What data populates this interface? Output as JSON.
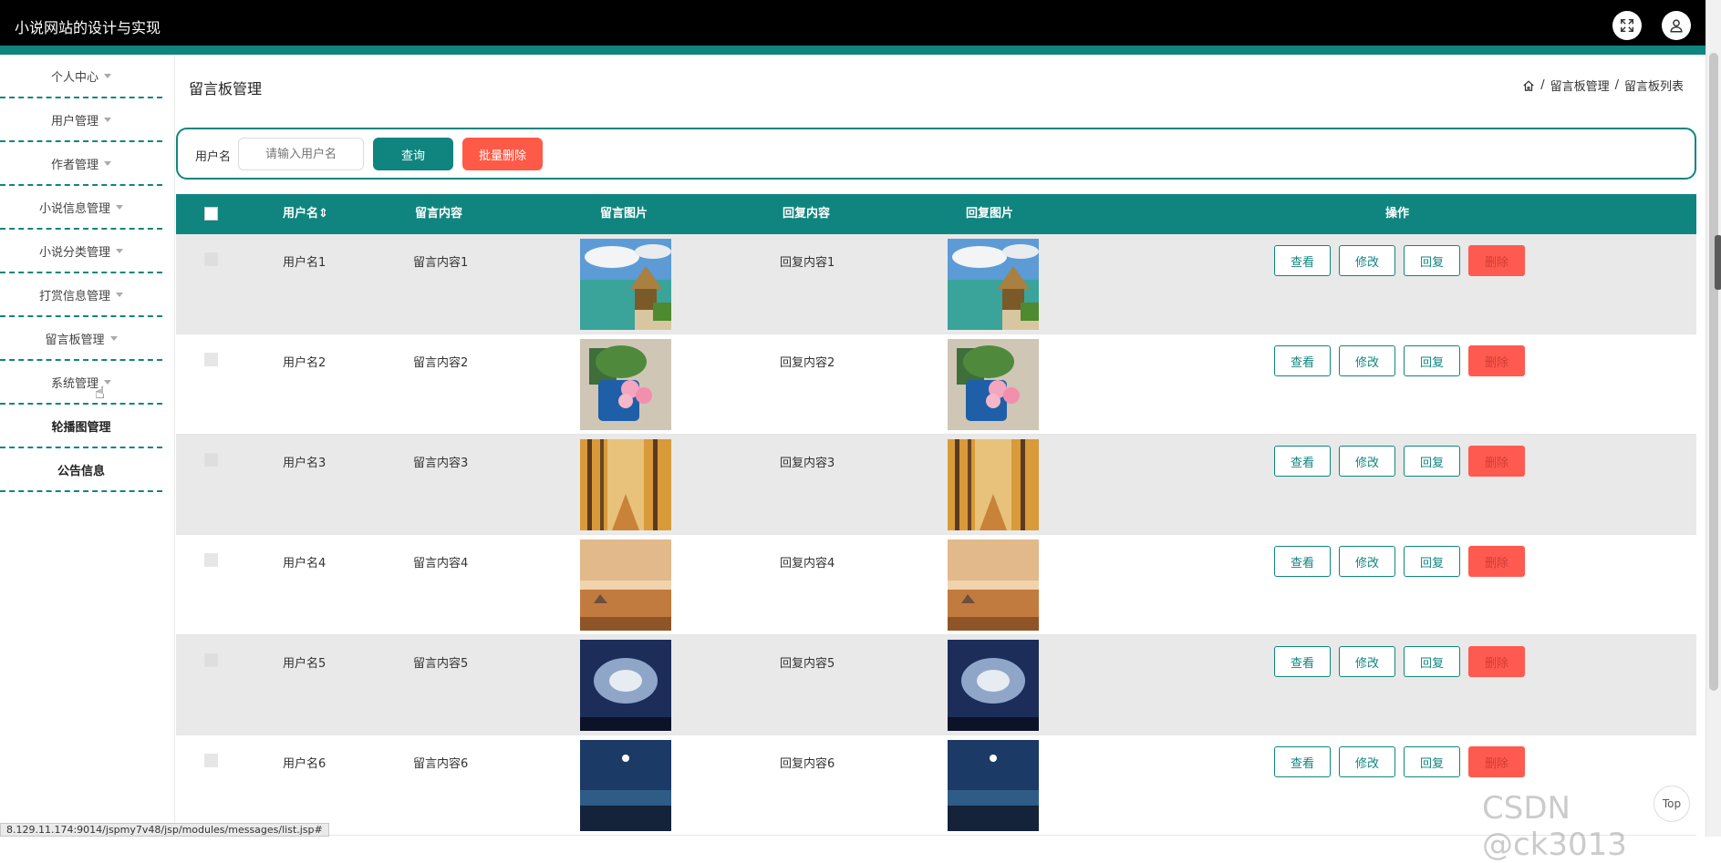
{
  "app": {
    "title": "小说网站的设计与实现"
  },
  "sidebar": {
    "items": [
      {
        "label": "个人中心",
        "caret": true
      },
      {
        "label": "用户管理",
        "caret": true
      },
      {
        "label": "作者管理",
        "caret": true
      },
      {
        "label": "小说信息管理",
        "caret": true
      },
      {
        "label": "小说分类管理",
        "caret": true
      },
      {
        "label": "打赏信息管理",
        "caret": true
      },
      {
        "label": "留言板管理",
        "caret": true
      },
      {
        "label": "系统管理",
        "caret": true
      },
      {
        "label": "轮播图管理",
        "caret": false
      },
      {
        "label": "公告信息",
        "caret": false
      }
    ]
  },
  "page": {
    "title": "留言板管理",
    "breadcrumb": [
      "留言板管理",
      "留言板列表"
    ],
    "breadcrumb_sep": "/"
  },
  "search": {
    "label": "用户名",
    "placeholder": "请输入用户名",
    "query_label": "查询",
    "batch_delete_label": "批量删除"
  },
  "table": {
    "columns": [
      "用户名",
      "留言内容",
      "留言图片",
      "回复内容",
      "回复图片",
      "操作"
    ],
    "sort_indicator": "⇕",
    "rows": [
      {
        "username": "用户名1",
        "content": "留言内容1",
        "image": "beach-hut",
        "reply": "回复内容1",
        "reply_image": "beach-hut"
      },
      {
        "username": "用户名2",
        "content": "留言内容2",
        "image": "flower-pot",
        "reply": "回复内容2",
        "reply_image": "flower-pot"
      },
      {
        "username": "用户名3",
        "content": "留言内容3",
        "image": "autumn-forest",
        "reply": "回复内容3",
        "reply_image": "autumn-forest"
      },
      {
        "username": "用户名4",
        "content": "留言内容4",
        "image": "misty-sunset",
        "reply": "回复内容4",
        "reply_image": "misty-sunset"
      },
      {
        "username": "用户名5",
        "content": "留言内容5",
        "image": "night-sky",
        "reply": "回复内容5",
        "reply_image": "night-sky"
      },
      {
        "username": "用户名6",
        "content": "留言内容6",
        "image": "coast-night",
        "reply": "回复内容6",
        "reply_image": "coast-night"
      }
    ],
    "actions": {
      "view": "查看",
      "edit": "修改",
      "reply": "回复",
      "delete": "删除"
    }
  },
  "status_url": "8.129.11.174:9014/jspmy7v48/jsp/modules/messages/list.jsp#",
  "top_button": "Top",
  "watermark": "CSDN @ck3013",
  "colors": {
    "accent": "#10857f",
    "danger": "#ff5a47",
    "topbar": "#000000"
  }
}
